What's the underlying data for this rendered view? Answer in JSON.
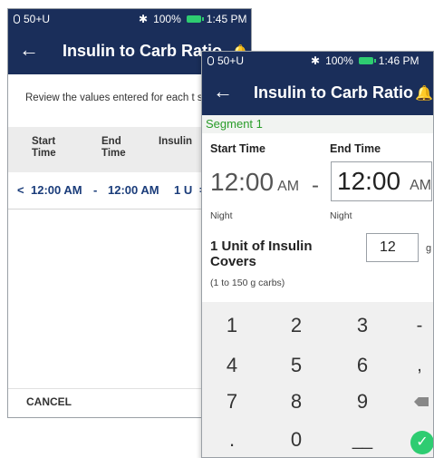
{
  "back_screen": {
    "status": {
      "label": "50+U",
      "battery": "100%",
      "time": "1:45 PM"
    },
    "title": "Insulin to Carb Ratio",
    "intro_text": "Review the values entered for each t segment.",
    "headers": {
      "start": "Start Time",
      "end": "End Time",
      "insulin": "Insulin"
    },
    "row": {
      "chevron": "<",
      "start": "12:00 AM",
      "sep": "-",
      "end": "12:00 AM",
      "insulin": "1 U",
      "cut": "="
    },
    "cancel_label": "CANCEL"
  },
  "front_screen": {
    "status": {
      "label": "50+U",
      "battery": "100%",
      "time": "1:46 PM"
    },
    "title": "Insulin to Carb Ratio",
    "segment_label": "Segment 1",
    "start_time_label": "Start Time",
    "end_time_label": "End Time",
    "start_time_value": "12:00",
    "start_time_ampm": "AM",
    "end_time_value": "12:00",
    "end_time_ampm": "AM",
    "separator": "-",
    "start_period": "Night",
    "end_period": "Night",
    "carb_label": "1 Unit of Insulin Covers",
    "carb_range": "(1 to 150 g carbs)",
    "carb_value": "12",
    "carb_unit": "g",
    "keypad": {
      "k1": "1",
      "k2": "2",
      "k3": "3",
      "minus": "-",
      "k4": "4",
      "k5": "5",
      "k6": "6",
      "comma": ",",
      "k7": "7",
      "k8": "8",
      "k9": "9",
      "dot": ".",
      "k0": "0",
      "space": "__"
    }
  },
  "colors": {
    "header_navy": "#1a2e5a",
    "segment_green": "#2a9d2a",
    "confirm_green": "#2ecc71"
  },
  "icons": [
    "pod-icon",
    "bluetooth-icon",
    "battery-icon",
    "back-arrow-icon",
    "bell-icon",
    "backspace-icon",
    "check-icon"
  ]
}
